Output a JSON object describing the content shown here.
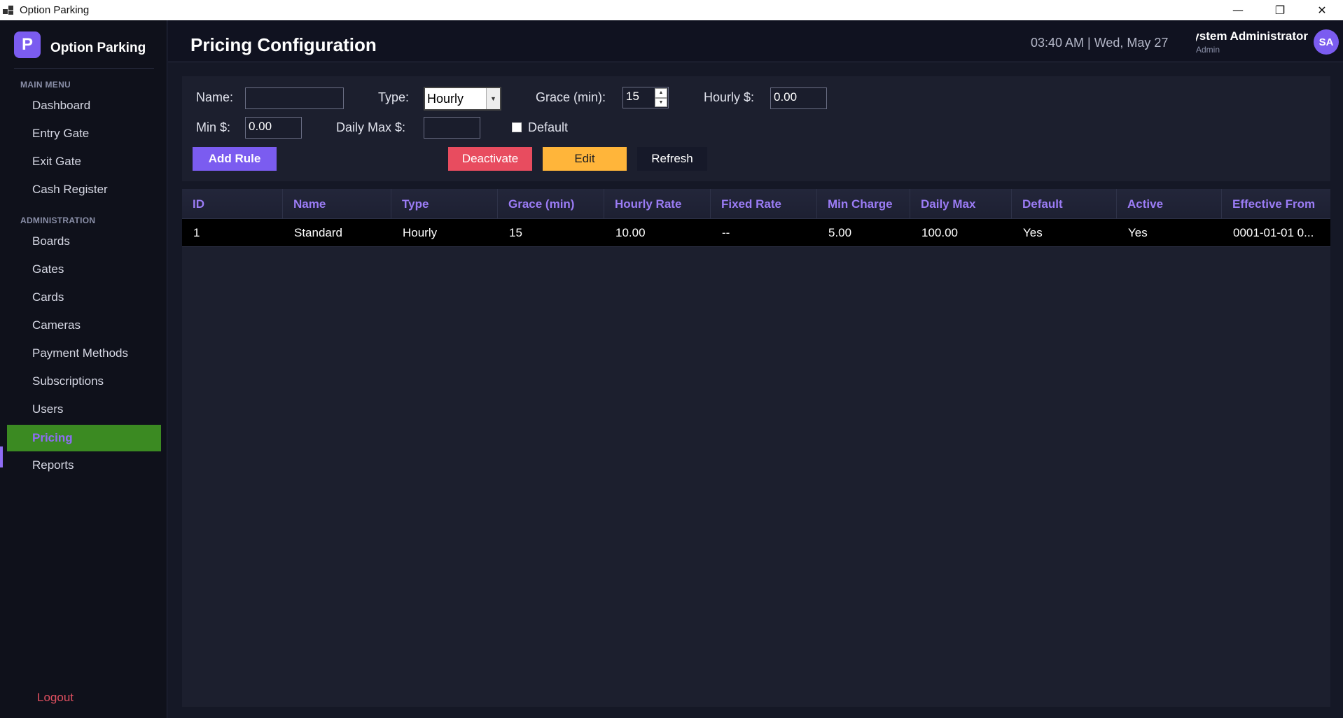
{
  "window": {
    "title": "Option Parking",
    "controls": {
      "minimize": "—",
      "maximize": "❐",
      "close": "✕"
    }
  },
  "sidebar": {
    "brand_badge": "P",
    "brand_name": "Option Parking",
    "sections": {
      "main": "MAIN MENU",
      "admin": "ADMINISTRATION"
    },
    "main_items": [
      "Dashboard",
      "Entry Gate",
      "Exit Gate",
      "Cash Register"
    ],
    "admin_items": [
      "Boards",
      "Gates",
      "Cards",
      "Cameras",
      "Payment Methods",
      "Subscriptions",
      "Users",
      "Pricing",
      "Reports"
    ],
    "active_item": "Pricing",
    "logout": "Logout",
    "colors": {
      "active_bg": "#3b8a22",
      "active_text": "#8f6cf5",
      "logout": "#e05060"
    }
  },
  "header": {
    "title": "Pricing Configuration",
    "clock": "03:40 AM  |  Wed, May 27",
    "user_name": "System Administrator",
    "user_role": "Admin",
    "avatar": "SA"
  },
  "form": {
    "name_label": "Name:",
    "name_value": "",
    "type_label": "Type:",
    "type_value": "Hourly",
    "grace_label": "Grace (min):",
    "grace_value": "15",
    "hourly_label": "Hourly $:",
    "hourly_value": "0.00",
    "min_label": "Min $:",
    "min_value": "0.00",
    "daily_max_label": "Daily Max $:",
    "daily_max_value": "",
    "default_label": "Default",
    "default_checked": false,
    "buttons": {
      "add": "Add Rule",
      "deactivate": "Deactivate",
      "edit": "Edit",
      "refresh": "Refresh"
    },
    "colors": {
      "add": "#7b5cf0",
      "deactivate": "#e84c5f",
      "edit": "#ffb53a"
    }
  },
  "table": {
    "columns": [
      "ID",
      "Name",
      "Type",
      "Grace (min)",
      "Hourly Rate",
      "Fixed Rate",
      "Min Charge",
      "Daily Max",
      "Default",
      "Active",
      "Effective From"
    ],
    "rows": [
      [
        "1",
        "Standard",
        "Hourly",
        "15",
        "10.00",
        "--",
        "5.00",
        "100.00",
        "Yes",
        "Yes",
        "0001-01-01 0..."
      ]
    ],
    "header_color": "#9b7cf5"
  }
}
